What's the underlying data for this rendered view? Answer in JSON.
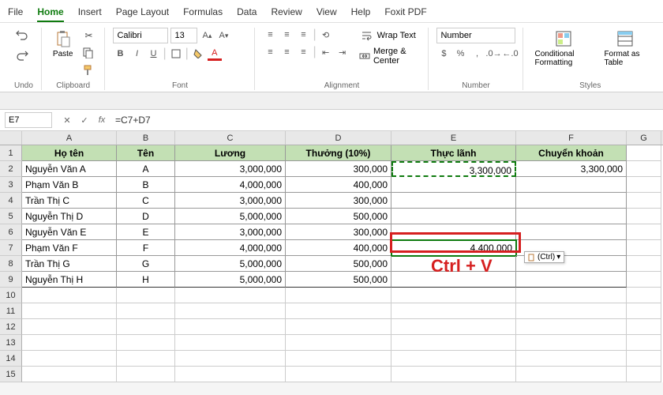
{
  "menu": [
    "File",
    "Home",
    "Insert",
    "Page Layout",
    "Formulas",
    "Data",
    "Review",
    "View",
    "Help",
    "Foxit PDF"
  ],
  "menu_active_index": 1,
  "ribbon": {
    "undo": {
      "label": "Undo"
    },
    "clipboard": {
      "label": "Clipboard",
      "paste": "Paste"
    },
    "font": {
      "label": "Font",
      "name": "Calibri",
      "size": "13"
    },
    "alignment": {
      "label": "Alignment",
      "wrap": "Wrap Text",
      "merge": "Merge & Center"
    },
    "number": {
      "label": "Number",
      "format": "Number"
    },
    "styles": {
      "label": "Styles",
      "cf": "Conditional Formatting",
      "fat": "Format as Table"
    }
  },
  "namebox": "E7",
  "formula": "=C7+D7",
  "columns": [
    "A",
    "B",
    "C",
    "D",
    "E",
    "F",
    "G"
  ],
  "headers": {
    "A": "Họ tên",
    "B": "Tên",
    "C": "Lương",
    "D": "Thưởng (10%)",
    "E": "Thực lãnh",
    "F": "Chuyển khoản"
  },
  "data_rows": [
    {
      "A": "Nguyễn Văn A",
      "B": "A",
      "C": "3,000,000",
      "D": "300,000",
      "E": "3,300,000",
      "F": "3,300,000"
    },
    {
      "A": "Phạm Văn B",
      "B": "B",
      "C": "4,000,000",
      "D": "400,000",
      "E": "",
      "F": ""
    },
    {
      "A": "Trần Thị C",
      "B": "C",
      "C": "3,000,000",
      "D": "300,000",
      "E": "",
      "F": ""
    },
    {
      "A": "Nguyễn Thị D",
      "B": "D",
      "C": "5,000,000",
      "D": "500,000",
      "E": "",
      "F": ""
    },
    {
      "A": "Nguyễn Văn E",
      "B": "E",
      "C": "3,000,000",
      "D": "300,000",
      "E": "",
      "F": ""
    },
    {
      "A": "Phạm Văn F",
      "B": "F",
      "C": "4,000,000",
      "D": "400,000",
      "E": "4,400,000",
      "F": ""
    },
    {
      "A": "Trần Thị G",
      "B": "G",
      "C": "5,000,000",
      "D": "500,000",
      "E": "",
      "F": ""
    },
    {
      "A": "Nguyễn Thị H",
      "B": "H",
      "C": "5,000,000",
      "D": "500,000",
      "E": "",
      "F": ""
    }
  ],
  "annotation": "Ctrl + V",
  "paste_tag": "(Ctrl)"
}
